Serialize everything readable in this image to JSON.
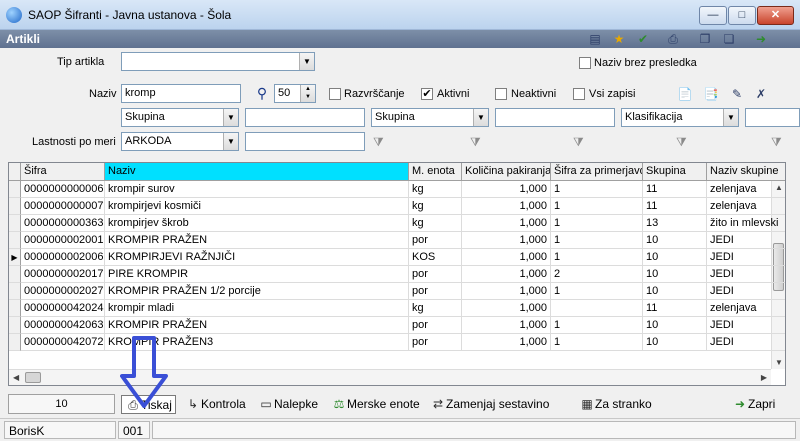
{
  "window": {
    "title": "SAOP Šifranti - Javna ustanova - Šola",
    "buttons": {
      "minimize": "—",
      "maximize": "□",
      "close": "✕"
    }
  },
  "header": {
    "title": "Artikli"
  },
  "filters": {
    "tip_artikla_label": "Tip artikla",
    "tip_artikla_value": "",
    "naziv_brez_presledka_label": "Naziv brez presledka",
    "naziv_label": "Naziv",
    "naziv_value": "kromp",
    "limit_value": "50",
    "razvrscanje_label": "Razvrščanje",
    "aktivni_label": "Aktivni",
    "aktivni_checked": true,
    "neaktivni_label": "Neaktivni",
    "vsi_zapisi_label": "Vsi zapisi",
    "skupina1_value": "Skupina",
    "skupina1_text": "",
    "skupina2_value": "Skupina",
    "skupina2_text": "",
    "klasifikacija_value": "Klasifikacija",
    "klasifikacija_text": "",
    "lastnosti_label": "Lastnosti po meri",
    "lastnosti_value": "ARKODA",
    "lastnosti_text": ""
  },
  "grid": {
    "columns": [
      "Šifra",
      "Naziv",
      "M. enota",
      "Količina pakiranja",
      "Šifra za primerjavo",
      "Skupina",
      "Naziv skupine"
    ],
    "rows": [
      [
        "0000000000006",
        "krompir surov",
        "kg",
        "1,000",
        "1",
        "11",
        "zelenjava"
      ],
      [
        "0000000000007",
        "krompirjevi kosmiči",
        "kg",
        "1,000",
        "1",
        "11",
        "zelenjava"
      ],
      [
        "0000000000363",
        "krompirjev škrob",
        "kg",
        "1,000",
        "1",
        "13",
        "žito in mlevski"
      ],
      [
        "0000000002001",
        "KROMPIR PRAŽEN",
        "por",
        "1,000",
        "1",
        "10",
        "JEDI"
      ],
      [
        "0000000002006",
        "KROMPIRJEVI RAŽNJIČI",
        "KOS",
        "1,000",
        "1",
        "10",
        "JEDI"
      ],
      [
        "0000000002017",
        "PIRE KROMPIR",
        "por",
        "1,000",
        "2",
        "10",
        "JEDI"
      ],
      [
        "0000000002027",
        "KROMPIR PRAŽEN 1/2 porcije",
        "por",
        "1,000",
        "1",
        "10",
        "JEDI"
      ],
      [
        "0000000042024",
        "krompir mladi",
        "kg",
        "1,000",
        "",
        "11",
        "zelenjava"
      ],
      [
        "0000000042063",
        "KROMPIR PRAŽEN",
        "por",
        "1,000",
        "1",
        "10",
        "JEDI"
      ],
      [
        "0000000042072",
        "KROMPIR PRAŽEN3",
        "por",
        "1,000",
        "1",
        "10",
        "JEDI"
      ]
    ],
    "current_row": 4
  },
  "toolbar": {
    "count": "10",
    "tiskaj": "Tiskaj",
    "kontrola": "Kontrola",
    "nalepke": "Nalepke",
    "merske_enote": "Merske enote",
    "zamenjaj_sestavino": "Zamenjaj sestavino",
    "za_stranko": "Za stranko",
    "zapri": "Zapri"
  },
  "status": {
    "user": "BorisK",
    "code": "001"
  },
  "colors": {
    "header_active": "#00e0ff",
    "title_band": "#6b7d98",
    "annotation_arrow": "#3a4fd6"
  }
}
